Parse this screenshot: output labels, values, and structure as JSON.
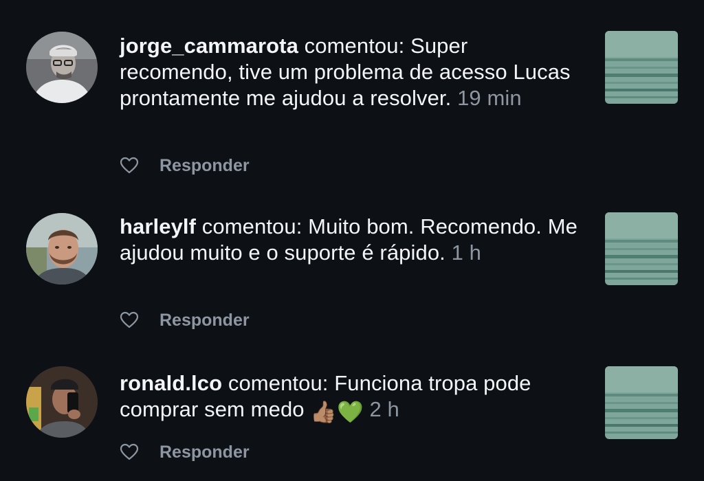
{
  "notifications": [
    {
      "username": "jorge_cammarota",
      "action": "comentou:",
      "message": "Super recomendo, tive um problema de acesso Lucas prontamente me ajudou a resolver.",
      "time": "19 min",
      "reply_label": "Responder",
      "avatar_icon": "person-glasses-avatar"
    },
    {
      "username": "harleylf",
      "action": "comentou:",
      "message": "Muito bom. Recomendo. Me ajudou muito e o suporte é rápido.",
      "time": "1 h",
      "reply_label": "Responder",
      "avatar_icon": "person-bearded-avatar"
    },
    {
      "username": "ronald.lco",
      "action": "comentou:",
      "message": "Funciona tropa pode comprar sem medo",
      "emojis": "👍🏽💚",
      "time": "2 h",
      "reply_label": "Responder",
      "avatar_icon": "person-selfie-avatar"
    }
  ],
  "colors": {
    "background": "#0d1014",
    "text": "#f3f5f8",
    "muted": "#8e97a1",
    "thumbnail": "#7fa69a"
  }
}
